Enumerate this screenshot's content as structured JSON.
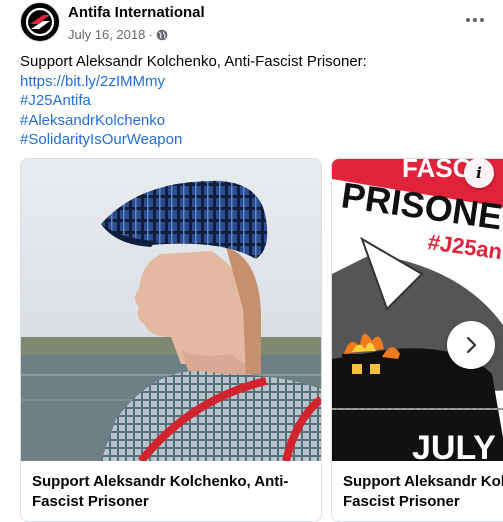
{
  "post": {
    "page_name": "Antifa International",
    "date": "July 16, 2018",
    "separator": "·",
    "privacy_icon": "globe-icon",
    "more_icon": "more-horizontal-icon",
    "text": {
      "line1": "Support Aleksandr Kolchenko, Anti-Fascist Prisoner:",
      "link": "https://bit.ly/2zIMMmy",
      "hashtags": [
        "#J25Antifa",
        "#AleksandrKolchenko",
        "#SolidarityIsOurWeapon"
      ]
    }
  },
  "carousel": {
    "cards": [
      {
        "title": "Support Aleksandr Kolchenko, Anti-Fascist Prisoner"
      },
      {
        "title": "Support Aleksandr Kolchenko, Anti-Fascist Prisoner"
      }
    ],
    "poster": {
      "line1": "PRISONE",
      "line1_prefix": "FASC",
      "hashtag": "#J25an",
      "bottom": "JULY"
    },
    "info_icon_label": "i",
    "next_icon": "chevron-right-icon"
  },
  "colors": {
    "link": "#216fdb",
    "meta": "#65676b",
    "poster_red": "#e0233a"
  }
}
